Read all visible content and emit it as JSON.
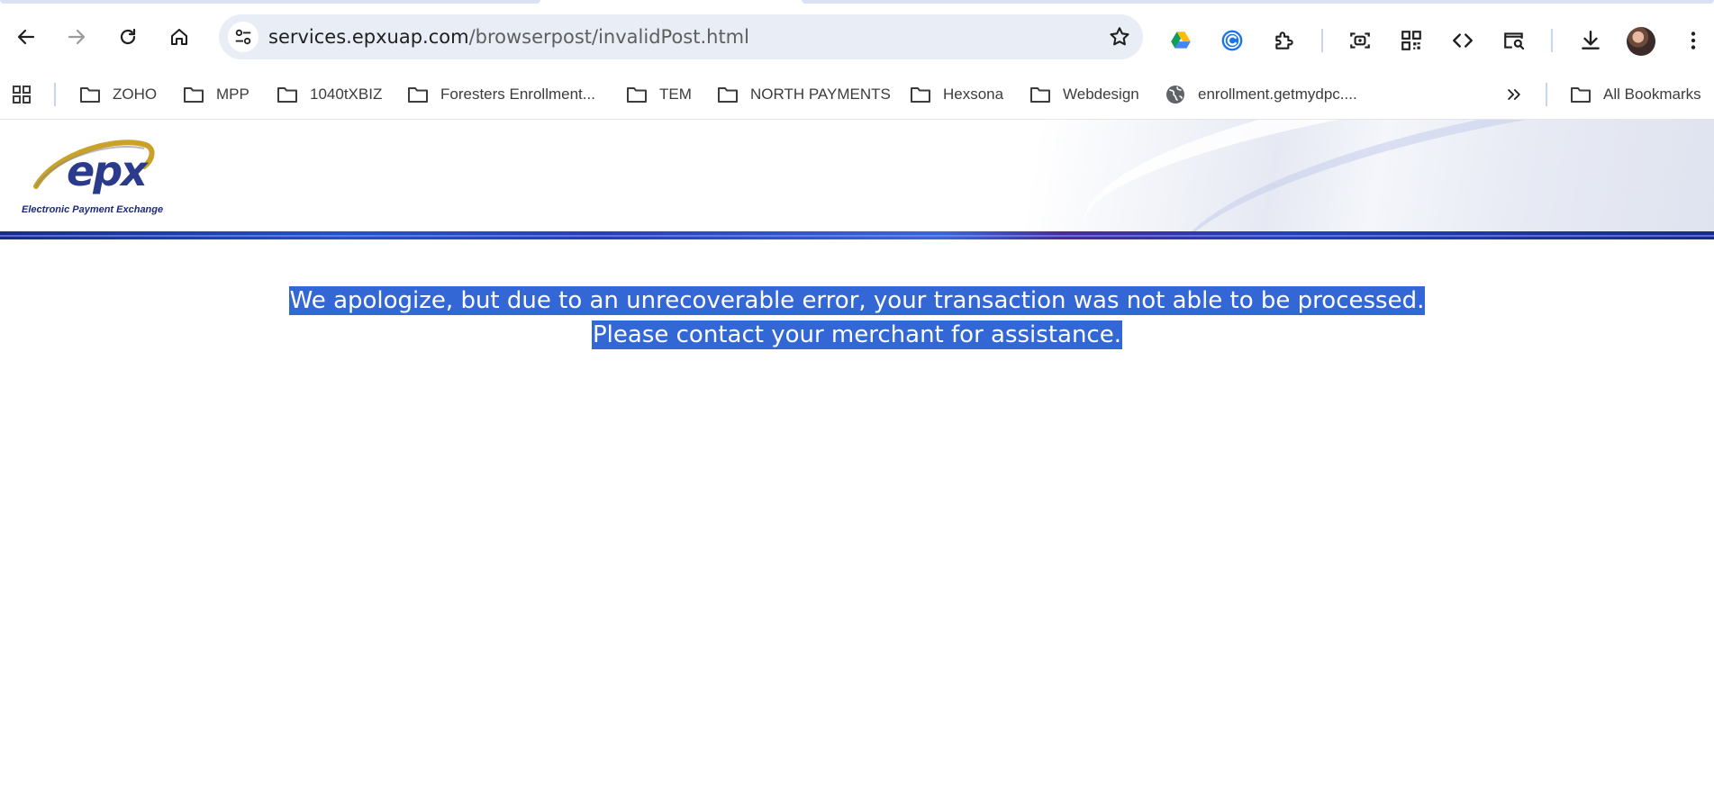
{
  "browser": {
    "url_host": "services.epxuap.com",
    "url_path": "/browserpost/invalidPost.html"
  },
  "bookmarks": [
    {
      "label": "ZOHO",
      "icon": "folder-icon"
    },
    {
      "label": "MPP",
      "icon": "folder-icon"
    },
    {
      "label": "1040tXBIZ",
      "icon": "folder-icon"
    },
    {
      "label": "Foresters Enrollment...",
      "icon": "folder-icon"
    },
    {
      "label": "TEM",
      "icon": "folder-icon"
    },
    {
      "label": "NORTH PAYMENTS",
      "icon": "folder-icon"
    },
    {
      "label": "Hexsona",
      "icon": "folder-icon"
    },
    {
      "label": "Webdesign",
      "icon": "folder-icon"
    },
    {
      "label": "enrollment.getmydpc....",
      "icon": "globe-icon"
    }
  ],
  "all_bookmarks_label": "All Bookmarks",
  "site": {
    "logo_text": "epx",
    "logo_tagline": "Electronic Payment Exchange",
    "error_line1": "We apologize, but due to an unrecoverable error, your transaction was not able to be processed.",
    "error_line2": "Please contact your merchant for assistance."
  },
  "colors": {
    "selection": "#3367d6",
    "omnibox_bg": "#e9eef6",
    "header_bar": "#2a3db8"
  }
}
